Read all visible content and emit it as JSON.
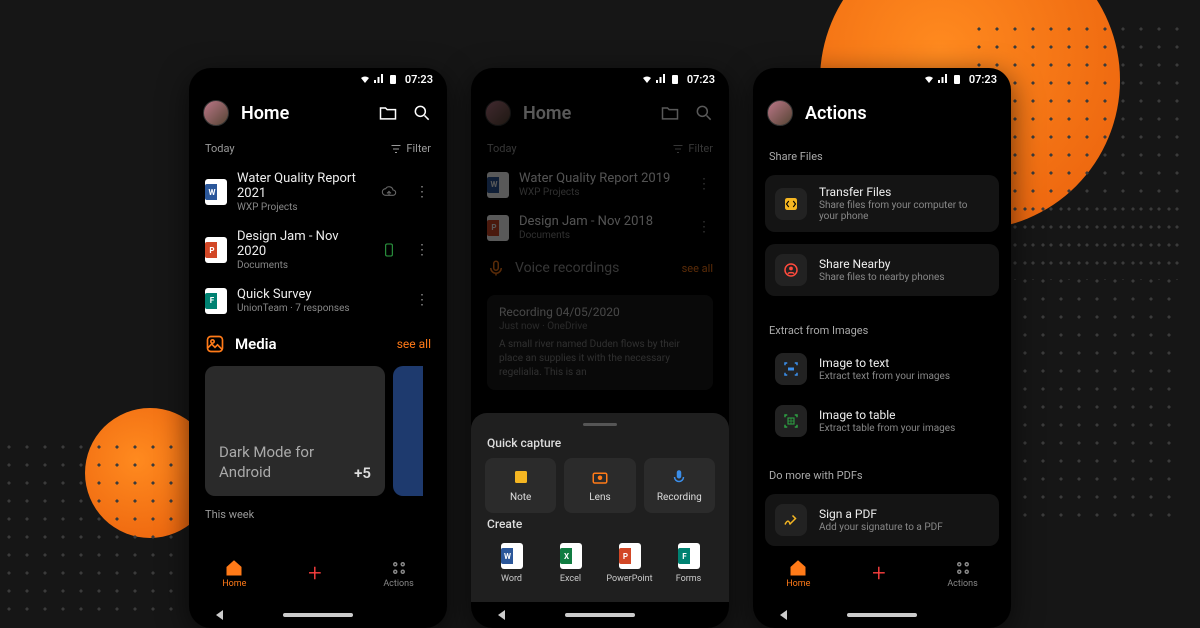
{
  "colors": {
    "accent": "#ff7a18",
    "bg": "#161616"
  },
  "status": {
    "time": "07:23"
  },
  "phone1": {
    "title": "Home",
    "today_label": "Today",
    "filter_label": "Filter",
    "files": [
      {
        "title": "Water Quality Report 2021",
        "subtitle": "WXP Projects",
        "type": "word",
        "sync": "cloud"
      },
      {
        "title": "Design Jam - Nov 2020",
        "subtitle": "Documents",
        "type": "ppt",
        "sync": "mobile"
      },
      {
        "title": "Quick Survey",
        "subtitle": "UnionTeam · 7 responses",
        "type": "forms",
        "sync": "none"
      }
    ],
    "media": {
      "label": "Media",
      "see_all": "see all",
      "card_text": "Dark Mode for Android",
      "count": "+5"
    },
    "this_week": "This week",
    "nav": {
      "home": "Home",
      "actions": "Actions"
    }
  },
  "phone2": {
    "title": "Home",
    "today_label": "Today",
    "filter_label": "Filter",
    "files": [
      {
        "title": "Water Quality Report 2019",
        "subtitle": "WXP Projects",
        "type": "word"
      },
      {
        "title": "Design Jam - Nov 2018",
        "subtitle": "Documents",
        "type": "ppt"
      }
    ],
    "voice": {
      "label": "Voice recordings",
      "see_all": "see all",
      "card_title": "Recording 04/05/2020",
      "card_sub": "Just now · OneDrive",
      "card_body": "A small river named Duden flows by their place an supplies it with the necessary regelialia. This is an"
    },
    "sheet": {
      "quick_label": "Quick capture",
      "quick": [
        {
          "label": "Note",
          "icon": "note"
        },
        {
          "label": "Lens",
          "icon": "lens"
        },
        {
          "label": "Recording",
          "icon": "recording"
        }
      ],
      "create_label": "Create",
      "create": [
        {
          "label": "Word",
          "type": "word"
        },
        {
          "label": "Excel",
          "type": "excel"
        },
        {
          "label": "PowerPoint",
          "type": "ppt"
        },
        {
          "label": "Forms",
          "type": "forms"
        }
      ]
    }
  },
  "phone3": {
    "title": "Actions",
    "sections": {
      "share": {
        "label": "Share Files",
        "items": [
          {
            "title": "Transfer Files",
            "subtitle": "Share files from your computer to your phone",
            "icon": "transfer",
            "color": "#f5b622"
          },
          {
            "title": "Share Nearby",
            "subtitle": "Share files to nearby phones",
            "icon": "nearby",
            "color": "#ff4a3d"
          }
        ]
      },
      "extract": {
        "label": "Extract from Images",
        "items": [
          {
            "title": "Image to text",
            "subtitle": "Extract text from your images",
            "icon": "imgtext",
            "color": "#3b8eea"
          },
          {
            "title": "Image to table",
            "subtitle": "Extract table from your images",
            "icon": "imgtable",
            "color": "#2ea043"
          }
        ]
      },
      "pdf": {
        "label": "Do more with PDFs",
        "items": [
          {
            "title": "Sign a PDF",
            "subtitle": "Add your signature to a PDF",
            "icon": "sign",
            "color": "#f5b622"
          }
        ]
      }
    },
    "nav": {
      "home": "Home",
      "actions": "Actions"
    }
  }
}
